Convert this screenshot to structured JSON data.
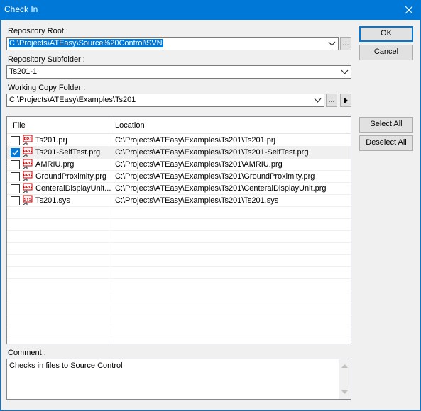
{
  "window": {
    "title": "Check In"
  },
  "repo_root": {
    "label": "Repository Root :",
    "value": "C:\\Projects\\ATEasy\\Source%20Control\\SVN",
    "browse_label": "..."
  },
  "repo_subfolder": {
    "label": "Repository Subfolder :",
    "value": "Ts201-1"
  },
  "working_copy": {
    "label": "Working Copy Folder :",
    "value": "C:\\Projects\\ATEasy\\Examples\\Ts201",
    "browse_label": "..."
  },
  "buttons": {
    "ok": "OK",
    "cancel": "Cancel",
    "select_all": "Select All",
    "deselect_all": "Deselect All"
  },
  "files": {
    "columns": [
      "File",
      "Location"
    ],
    "rows": [
      {
        "checked": false,
        "icon": "prj-file-icon",
        "icon_text": "PRJ",
        "name": "Ts201.prj",
        "location": "C:\\Projects\\ATEasy\\Examples\\Ts201\\Ts201.prj"
      },
      {
        "checked": true,
        "icon": "prg-file-icon",
        "icon_text": "PRG",
        "name": "Ts201-SelfTest.prg",
        "location": "C:\\Projects\\ATEasy\\Examples\\Ts201\\Ts201-SelfTest.prg"
      },
      {
        "checked": false,
        "icon": "prg-file-icon",
        "icon_text": "PRG",
        "name": "AMRIU.prg",
        "location": "C:\\Projects\\ATEasy\\Examples\\Ts201\\AMRIU.prg"
      },
      {
        "checked": false,
        "icon": "prg-file-icon",
        "icon_text": "PRG",
        "name": "GroundProximity.prg",
        "location": "C:\\Projects\\ATEasy\\Examples\\Ts201\\GroundProximity.prg"
      },
      {
        "checked": false,
        "icon": "prg-file-icon",
        "icon_text": "PRG",
        "name": "CenteralDisplayUnit....",
        "location": "C:\\Projects\\ATEasy\\Examples\\Ts201\\CenteralDisplayUnit.prg"
      },
      {
        "checked": false,
        "icon": "sys-file-icon",
        "icon_text": "SYS",
        "name": "Ts201.sys",
        "location": "C:\\Projects\\ATEasy\\Examples\\Ts201\\Ts201.sys"
      }
    ]
  },
  "comment": {
    "label": "Comment :",
    "value": "Checks in files to Source Control"
  },
  "colors": {
    "accent": "#0078d7",
    "icon_red": "#cc0000"
  }
}
